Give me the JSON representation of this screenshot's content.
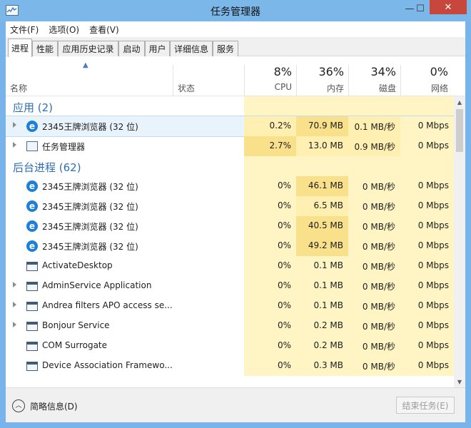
{
  "window": {
    "title": "任务管理器",
    "min_glyph": "—",
    "max_glyph": "☐",
    "close_glyph": "✕",
    "icon": "task-manager-icon"
  },
  "menu": [
    "文件(F)",
    "选项(O)",
    "查看(V)"
  ],
  "tabs": [
    "进程",
    "性能",
    "应用历史记录",
    "启动",
    "用户",
    "详细信息",
    "服务"
  ],
  "active_tab": "进程",
  "header": {
    "sort_glyph": "▲",
    "name": "名称",
    "status": "状态",
    "cpu_pct": "8%",
    "cpu": "CPU",
    "mem_pct": "36%",
    "mem": "内存",
    "disk_pct": "34%",
    "disk": "磁盘",
    "net_pct": "0%",
    "net": "网络"
  },
  "groups": {
    "apps": "应用 (2)",
    "background": "后台进程 (62)"
  },
  "apps": [
    {
      "name": "2345王牌浏览器 (32 位)",
      "icon": "browser-e-icon",
      "expandable": true,
      "selected": true,
      "cpu": "0.2%",
      "mem": "70.9 MB",
      "disk": "0.1 MB/秒",
      "net": "0 Mbps"
    },
    {
      "name": "任务管理器",
      "icon": "task-manager-icon",
      "expandable": true,
      "selected": false,
      "cpu": "2.7%",
      "mem": "13.0 MB",
      "disk": "0.9 MB/秒",
      "net": "0 Mbps"
    }
  ],
  "background": [
    {
      "name": "2345王牌浏览器 (32 位)",
      "icon": "browser-e-icon",
      "expandable": false,
      "cpu": "0%",
      "mem": "46.1 MB",
      "disk": "0 MB/秒",
      "net": "0 Mbps"
    },
    {
      "name": "2345王牌浏览器 (32 位)",
      "icon": "browser-e-icon",
      "expandable": false,
      "cpu": "0%",
      "mem": "6.5 MB",
      "disk": "0 MB/秒",
      "net": "0 Mbps"
    },
    {
      "name": "2345王牌浏览器 (32 位)",
      "icon": "browser-e-icon",
      "expandable": false,
      "cpu": "0%",
      "mem": "40.5 MB",
      "disk": "0 MB/秒",
      "net": "0 Mbps"
    },
    {
      "name": "2345王牌浏览器 (32 位)",
      "icon": "browser-e-icon",
      "expandable": false,
      "cpu": "0%",
      "mem": "49.2 MB",
      "disk": "0 MB/秒",
      "net": "0 Mbps"
    },
    {
      "name": "ActivateDesktop",
      "icon": "window-app-icon",
      "expandable": false,
      "cpu": "0%",
      "mem": "0.1 MB",
      "disk": "0 MB/秒",
      "net": "0 Mbps"
    },
    {
      "name": "AdminService Application",
      "icon": "window-app-icon",
      "expandable": true,
      "cpu": "0%",
      "mem": "0.1 MB",
      "disk": "0 MB/秒",
      "net": "0 Mbps"
    },
    {
      "name": "Andrea filters APO access se...",
      "icon": "window-app-icon",
      "expandable": true,
      "cpu": "0%",
      "mem": "0.1 MB",
      "disk": "0 MB/秒",
      "net": "0 Mbps"
    },
    {
      "name": "Bonjour Service",
      "icon": "window-app-icon",
      "expandable": true,
      "cpu": "0%",
      "mem": "0.2 MB",
      "disk": "0 MB/秒",
      "net": "0 Mbps"
    },
    {
      "name": "COM Surrogate",
      "icon": "window-app-icon",
      "expandable": false,
      "cpu": "0%",
      "mem": "0.2 MB",
      "disk": "0 MB/秒",
      "net": "0 Mbps"
    },
    {
      "name": "Device Association Framewo...",
      "icon": "window-app-icon",
      "expandable": false,
      "cpu": "0%",
      "mem": "0.3 MB",
      "disk": "0 MB/秒",
      "net": "0 Mbps"
    }
  ],
  "footer": {
    "fewer_details": "简略信息(D)",
    "fewer_glyph": "︿",
    "end_task": "结束任务(E)"
  },
  "colors": {
    "heat_light": "#fff4c4",
    "heat_mid": "#ffefb0",
    "heat_strong": "#f9e08b",
    "group_title": "#2e6fb7",
    "selection": "#e9f3fb"
  }
}
